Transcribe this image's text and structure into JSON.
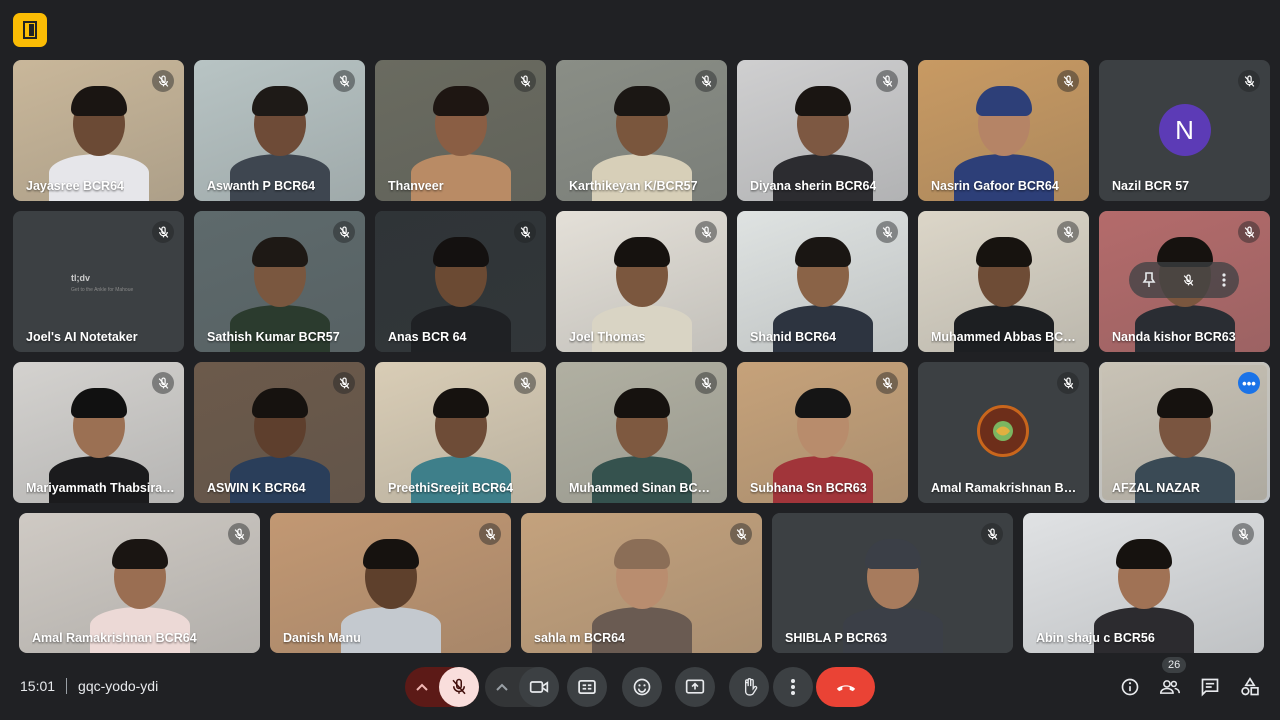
{
  "meeting": {
    "time": "15:01",
    "code": "gqc-yodo-ydi"
  },
  "participants_count": "26",
  "rows": [
    [
      {
        "name": "Jayasree BCR64",
        "bg": "#c9b79a",
        "skin": "#6b4a35",
        "shirt": "#e6e6ea",
        "hair": "#1a1512"
      },
      {
        "name": "Aswanth P BCR64",
        "bg": "#b8c4c4",
        "skin": "#6e4b37",
        "shirt": "#3e4650",
        "hair": "#1e1a17"
      },
      {
        "name": "Thanveer",
        "bg": "#6a6b60",
        "skin": "#8a5e44",
        "shirt": "#b98b65",
        "hair": "#1e1612"
      },
      {
        "name": "Karthikeyan K/BCR57",
        "bg": "#8a8e86",
        "skin": "#7a563d",
        "shirt": "#d7cfb8",
        "hair": "#1b1714"
      },
      {
        "name": "Diyana sherin BCR64",
        "bg": "#cfcfd0",
        "skin": "#7d5842",
        "shirt": "#2c2c30",
        "hair": "#1a1512"
      },
      {
        "name": "Nasrin Gafoor BCR64",
        "bg": "#c89a63",
        "skin": "#b58466",
        "shirt": "#2d3f78",
        "hair": "#2d3f78"
      },
      {
        "name": "Nazil BCR 57",
        "avatar": "N"
      }
    ],
    [
      {
        "name": "Joel's AI Notetaker",
        "tldv": "tl;dv",
        "tldv_sub": "Get to the Ankle for Mahoue"
      },
      {
        "name": "Sathish Kumar BCR57",
        "bg": "#5e6a6c",
        "skin": "#7a573f",
        "shirt": "#2b3b2e",
        "hair": "#1e1915"
      },
      {
        "name": "Anas BCR 64",
        "bg": "#2f3437",
        "skin": "#6b4a33",
        "shirt": "#1f2124",
        "hair": "#141110"
      },
      {
        "name": "Joel Thomas",
        "bg": "#e4e0d8",
        "skin": "#7b573e",
        "shirt": "#d9d4c4",
        "hair": "#16120f"
      },
      {
        "name": "Shanid BCR64",
        "bg": "#dfe3e2",
        "skin": "#8a6347",
        "shirt": "#2d3440",
        "hair": "#1a1613"
      },
      {
        "name": "Muhammed Abbas BCR...",
        "bg": "#dcd6c8",
        "skin": "#6e4c36",
        "shirt": "#1d1f22",
        "hair": "#17130f"
      },
      {
        "name": "Nanda kishor BCR63",
        "bg": "#b46b6b",
        "skin": "#7a563e",
        "shirt": "#2a2d33",
        "hair": "#16120f",
        "hover": true
      }
    ],
    [
      {
        "name": "Mariyammath Thabsira ...",
        "bg": "#d4d2cf",
        "skin": "#9b7053",
        "shirt": "#1b1b1d",
        "hair": "#111"
      },
      {
        "name": "ASWIN K BCR64",
        "bg": "#6c5a4b",
        "skin": "#5e3f2d",
        "shirt": "#2a3e5a",
        "hair": "#16120f"
      },
      {
        "name": "PreethiSreejit BCR64",
        "bg": "#d9cdb6",
        "skin": "#6e4c37",
        "shirt": "#3e7f8a",
        "hair": "#16120f"
      },
      {
        "name": "Muhammed Sinan BCR64",
        "bg": "#b1b0a2",
        "skin": "#7e5940",
        "shirt": "#35524e",
        "hair": "#16120f"
      },
      {
        "name": "Subhana Sn BCR63",
        "bg": "#c6a27a",
        "skin": "#b88c6c",
        "shirt": "#a1353a",
        "hair": "#151515"
      },
      {
        "name": "Amal Ramakrishnan BC...",
        "logo": true
      },
      {
        "name": "AFZAL NAZAR",
        "bg": "#c9c3b6",
        "skin": "#7a5540",
        "shirt": "#3a4a55",
        "hair": "#16120f",
        "active": true
      }
    ],
    [
      {
        "name": "Amal Ramakrishnan BCR64",
        "bg": "#cfcac4",
        "skin": "#9a6e52",
        "shirt": "#ecd9d6",
        "hair": "#1a1512"
      },
      {
        "name": "Danish Manu",
        "bg": "#c29873",
        "skin": "#5e402c",
        "shirt": "#c4c9cf",
        "hair": "#16120f"
      },
      {
        "name": "sahla m BCR64",
        "bg": "#c4a27d",
        "skin": "#b98d6f",
        "shirt": "#6a5b52",
        "hair": "#8b6e57"
      },
      {
        "name": "SHIBLA P BCR63",
        "bg": "#3c4043",
        "skin": "#a77b5d",
        "shirt": "#3b3f47",
        "hair": "#3b3f47"
      },
      {
        "name": "Abin shaju c BCR56",
        "bg": "#e0e2e4",
        "skin": "#a07255",
        "shirt": "#2c2b2f",
        "hair": "#16120f"
      }
    ]
  ],
  "icons": {
    "mic_off": "mic-off-icon",
    "camera": "camera-icon",
    "captions": "captions-icon",
    "emoji": "emoji-icon",
    "present": "present-icon",
    "raise_hand": "raise-hand-icon",
    "more": "more-vert-icon",
    "hangup": "hangup-icon",
    "info": "info-icon",
    "people": "people-icon",
    "chat": "chat-icon",
    "activities": "activities-icon"
  },
  "colors": {
    "background": "#202124",
    "accent": "#8ab4f8",
    "danger": "#ea4335",
    "logo": "#fbbc04"
  }
}
